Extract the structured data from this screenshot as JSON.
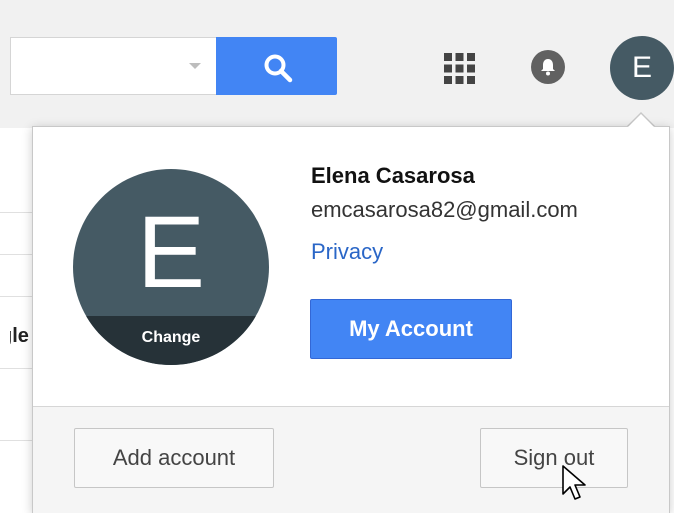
{
  "header": {
    "search": {
      "value": "",
      "placeholder": ""
    },
    "icons": [
      "search-icon",
      "apps-grid-icon",
      "notifications-bell-icon"
    ],
    "avatar_initial": "E"
  },
  "background": {
    "partial_text": "gle"
  },
  "account_menu": {
    "avatar_initial": "E",
    "change_label": "Change",
    "name": "Elena Casarosa",
    "email": "emcasarosa82@gmail.com",
    "privacy_label": "Privacy",
    "my_account_label": "My Account",
    "add_account_label": "Add account",
    "sign_out_label": "Sign out"
  },
  "colors": {
    "accent_blue": "#4285f4",
    "avatar_bg": "#455a64",
    "link_blue": "#2a66c7"
  }
}
